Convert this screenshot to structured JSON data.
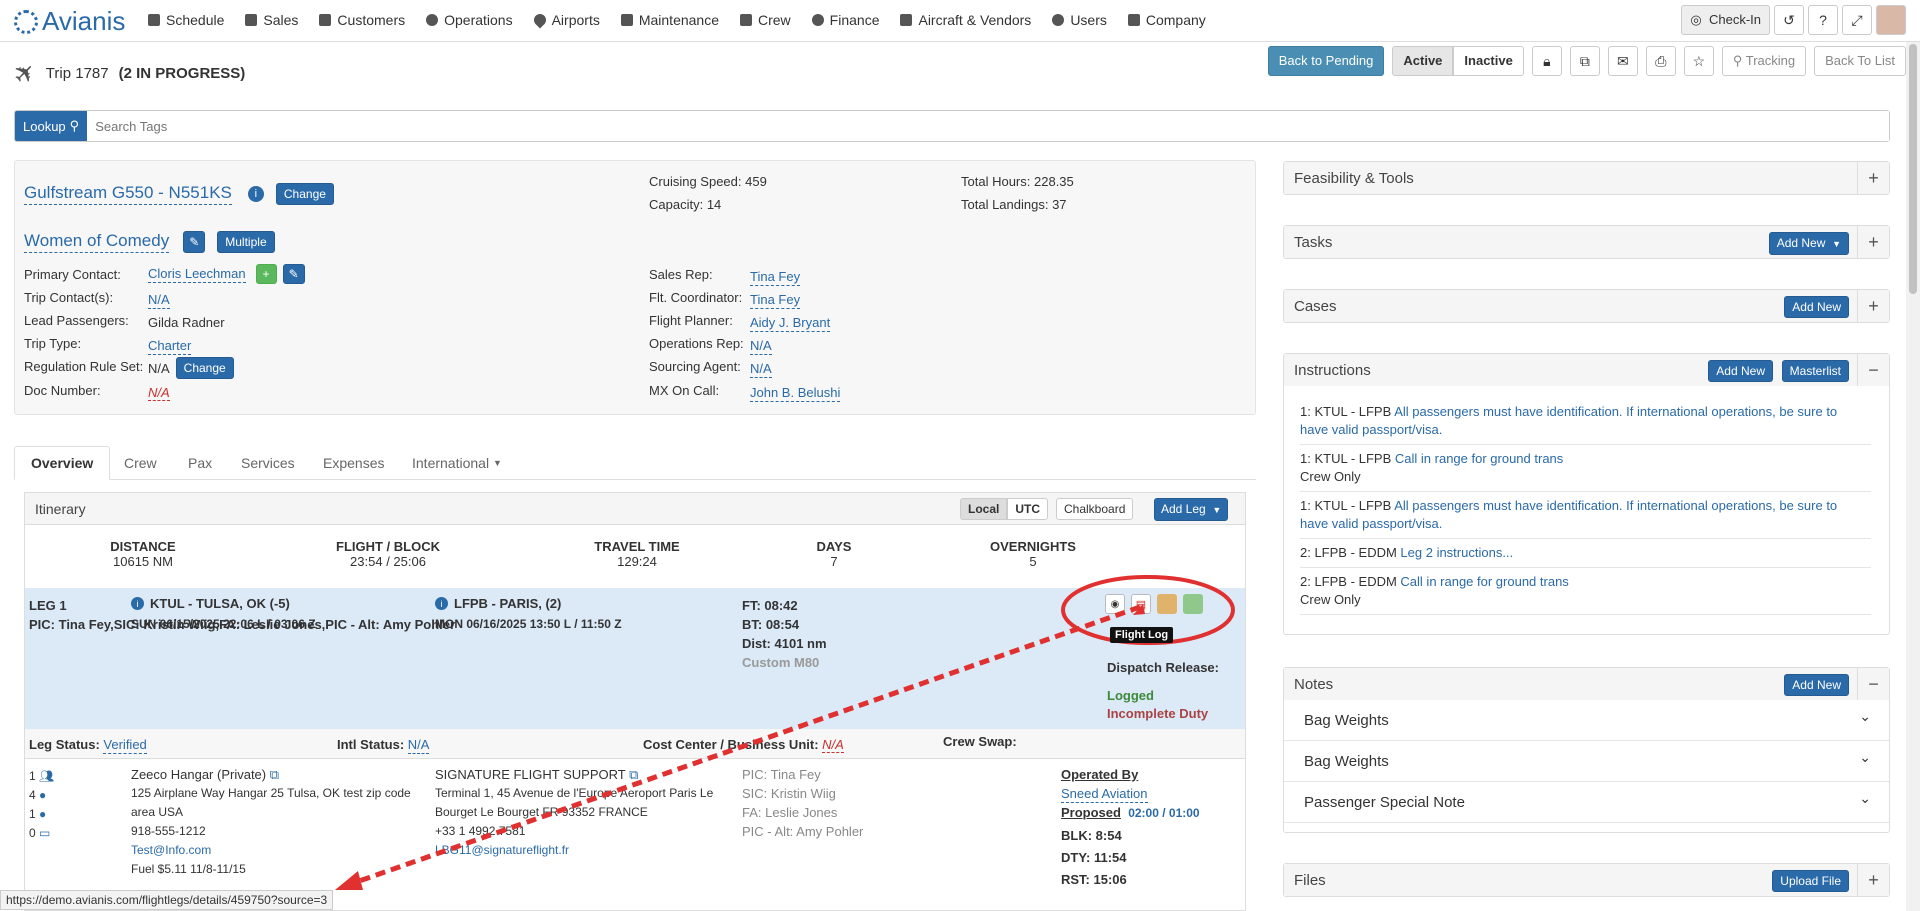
{
  "nav": {
    "logo": "Avianis",
    "items": [
      "Schedule",
      "Sales",
      "Customers",
      "Operations",
      "Airports",
      "Maintenance",
      "Crew",
      "Finance",
      "Aircraft & Vendors",
      "Users",
      "Company"
    ],
    "checkin": "Check-In"
  },
  "trip": {
    "title": "Trip 1787",
    "status": "(2 IN PROGRESS)",
    "back_pending": "Back to Pending",
    "active": "Active",
    "inactive": "Inactive",
    "tracking": "Tracking",
    "back_list": "Back To List"
  },
  "search": {
    "lookup": "Lookup",
    "placeholder": "Search Tags"
  },
  "aircraft": {
    "name": "Gulfstream G550 - N551KS",
    "change": "Change",
    "cruise_label": "Cruising Speed:",
    "cruise": "459",
    "cap_label": "Capacity:",
    "cap": "14",
    "hours_label": "Total Hours:",
    "hours": "228.35",
    "landings_label": "Total Landings:",
    "landings": "37",
    "trip_name": "Women of Comedy",
    "multiple": "Multiple",
    "primary_label": "Primary Contact:",
    "primary": "Cloris Leechman",
    "contacts_label": "Trip Contact(s):",
    "contacts": "N/A",
    "lead_label": "Lead Passengers:",
    "lead": "Gilda Radner",
    "type_label": "Trip Type:",
    "type": "Charter",
    "reg_label": "Regulation Rule Set:",
    "reg": "N/A",
    "doc_label": "Doc Number:",
    "doc": "N/A",
    "sales_label": "Sales Rep:",
    "sales": "Tina Fey",
    "coord_label": "Flt. Coordinator:",
    "coord": "Tina Fey",
    "planner_label": "Flight Planner:",
    "planner": "Aidy J. Bryant",
    "ops_label": "Operations Rep:",
    "ops": "N/A",
    "sourcing_label": "Sourcing Agent:",
    "sourcing": "N/A",
    "mx_label": "MX On Call:",
    "mx": "John B. Belushi"
  },
  "tabs": [
    "Overview",
    "Crew",
    "Pax",
    "Services",
    "Expenses",
    "International"
  ],
  "itinerary": {
    "title": "Itinerary",
    "local": "Local",
    "utc": "UTC",
    "chalkboard": "Chalkboard",
    "add_leg": "Add Leg",
    "stats": [
      {
        "t": "DISTANCE",
        "v": "10615 NM"
      },
      {
        "t": "FLIGHT / BLOCK",
        "v": "23:54 / 25:06"
      },
      {
        "t": "TRAVEL TIME",
        "v": "129:24"
      },
      {
        "t": "DAYS",
        "v": "7"
      },
      {
        "t": "OVERNIGHTS",
        "v": "5"
      }
    ]
  },
  "leg": {
    "name": "LEG 1",
    "crew": [
      "PIC: Tina Fey",
      "SIC: Kristin Wiig",
      "FA: Leslie Jones",
      "PIC - Alt: Amy Pohler"
    ],
    "from": "KTUL - TULSA, OK (-5)",
    "from_time": "SUN 06/15/2025 22:06 L / 03:06 Z",
    "to": "LFPB - PARIS, (2)",
    "to_time": "MON 06/16/2025 13:50 L / 11:50 Z",
    "ft": "FT: 08:42",
    "bt": "BT: 08:54",
    "dist": "Dist: 4101 nm",
    "custom": "Custom M80",
    "tooltip": "Flight Log",
    "dispatch": "Dispatch Release:",
    "logged": "Logged",
    "incomplete": "Incomplete Duty",
    "leg_status_label": "Leg Status:",
    "leg_status": "Verified",
    "intl_label": "Intl Status:",
    "intl": "N/A",
    "cost_label": "Cost Center / Business Unit:",
    "cost": "N/A",
    "swap": "Crew Swap:",
    "counts": [
      "1",
      "4",
      "1",
      "0"
    ],
    "fbo1": {
      "name": "Zeeco Hangar (Private)",
      "addr1": "125 Airplane Way Hangar 25 Tulsa, OK test zip code",
      "addr2": "area USA",
      "phone": "918-555-1212",
      "email": "Test@Info.com",
      "fuel": "Fuel $5.11 11/8-11/15"
    },
    "fbo2": {
      "name": "SIGNATURE FLIGHT SUPPORT",
      "addr1": "Terminal 1, 45 Avenue de l'Europe Aeroport Paris Le",
      "addr2": "Bourget Le Bourget FR 93352 FRANCE",
      "phone": "+33 1 4992 7581",
      "email": "LBG11@signatureflight.fr"
    },
    "operated_label": "Operated By",
    "operator": "Sneed Aviation",
    "proposed_label": "Proposed",
    "proposed": "02:00 / 01:00",
    "blk": "BLK: 8:54",
    "dty": "DTY: 11:54",
    "rst": "RST: 15:06"
  },
  "right": {
    "feas": "Feasibility & Tools",
    "tasks": "Tasks",
    "add_new": "Add New",
    "cases": "Cases",
    "instructions": "Instructions",
    "masterlist": "Masterlist",
    "instr": [
      {
        "code": "1: KTUL - LFPB",
        "text": "All passengers must have identification. If international operations, be sure to have valid passport/visa.",
        "sub": ""
      },
      {
        "code": "1: KTUL - LFPB",
        "text": "Call in range for ground trans",
        "sub": "Crew Only"
      },
      {
        "code": "1: KTUL - LFPB",
        "text": "All passengers must have identification. If international operations, be sure to have valid passport/visa.",
        "sub": ""
      },
      {
        "code": "2: LFPB - EDDM",
        "text": "Leg 2 instructions...",
        "sub": ""
      },
      {
        "code": "2: LFPB - EDDM",
        "text": "Call in range for ground trans",
        "sub": "Crew Only"
      }
    ],
    "notes": "Notes",
    "note_items": [
      "Bag Weights",
      "Bag Weights",
      "Passenger Special Note"
    ],
    "files": "Files",
    "upload": "Upload File"
  },
  "status_url": "https://demo.avianis.com/flightlegs/details/459750?source=3"
}
